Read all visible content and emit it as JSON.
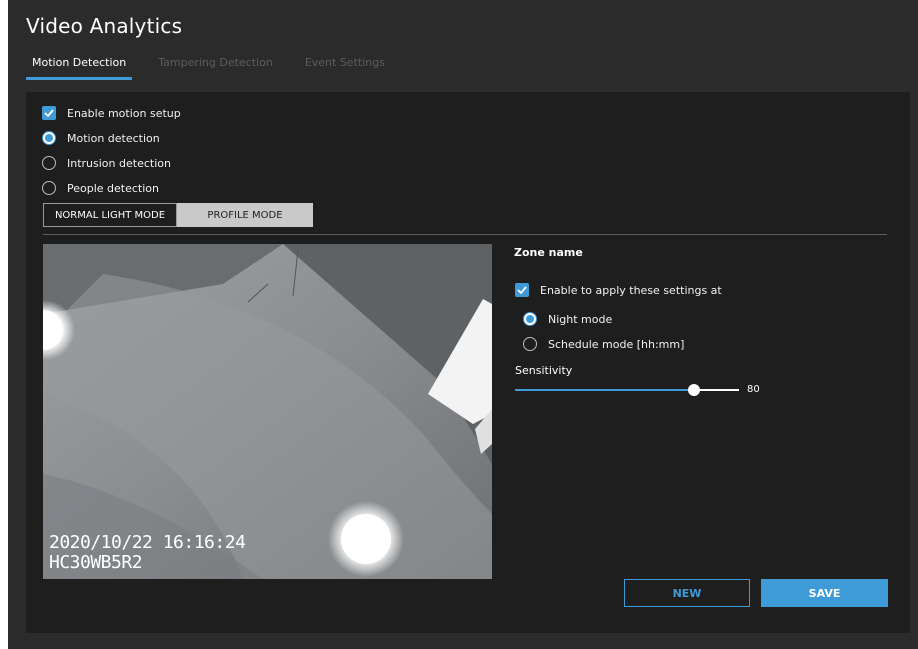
{
  "app": {
    "title": "Video Analytics"
  },
  "tabs": [
    {
      "label": "Motion Detection",
      "active": true
    },
    {
      "label": "Tampering Detection",
      "active": false
    },
    {
      "label": "Event Settings",
      "active": false
    }
  ],
  "options": {
    "enable_motion_setup": {
      "label": "Enable motion setup",
      "checked": true
    },
    "detection_modes": [
      {
        "label": "Motion detection",
        "selected": true
      },
      {
        "label": "Intrusion detection",
        "selected": false
      },
      {
        "label": "People detection",
        "selected": false
      }
    ]
  },
  "mode_buttons": [
    {
      "label": "NORMAL LIGHT MODE",
      "active": true
    },
    {
      "label": "PROFILE MODE",
      "active": false
    }
  ],
  "video": {
    "timestamp": "2020/10/22 16:16:24",
    "camera_id": "HC30WB5R2"
  },
  "zone": {
    "title": "Zone name",
    "apply_settings": {
      "label": "Enable to apply these settings at",
      "checked": true
    },
    "schedule_modes": [
      {
        "label": "Night mode",
        "selected": true
      },
      {
        "label": "Schedule mode [hh:mm]",
        "selected": false
      }
    ],
    "sensitivity_label": "Sensitivity",
    "sensitivity_value": "80",
    "sensitivity_fraction": 0.8
  },
  "actions": {
    "new_label": "NEW",
    "save_label": "SAVE"
  },
  "colors": {
    "accent": "#3f9bd8",
    "panel": "#1e1e1e",
    "background": "#2b2b2b"
  }
}
